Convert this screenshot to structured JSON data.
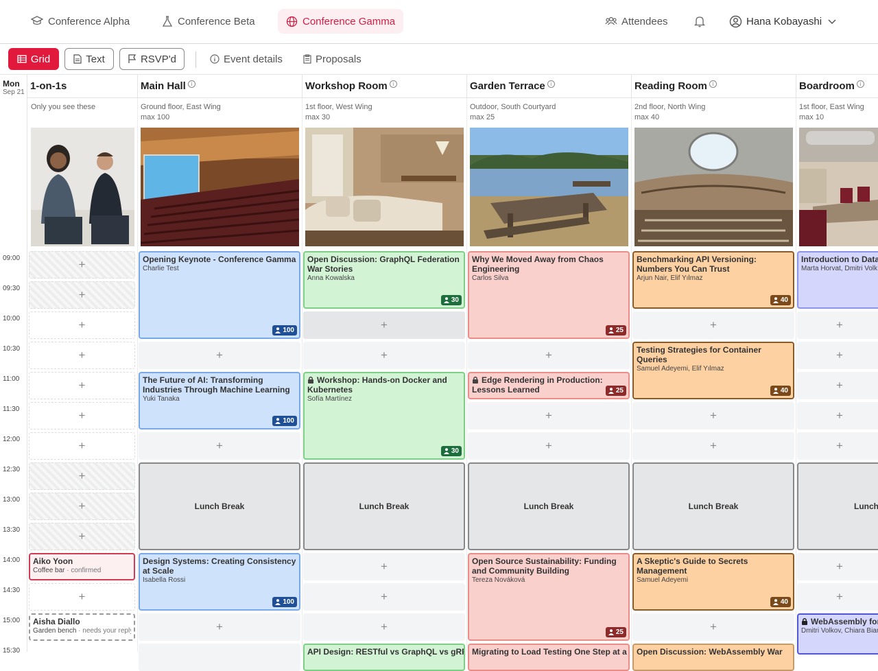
{
  "nav": {
    "tabs": [
      {
        "label": "Conference Alpha",
        "icon": "graduation-cap-icon"
      },
      {
        "label": "Conference Beta",
        "icon": "flask-icon"
      },
      {
        "label": "Conference Gamma",
        "icon": "globe-icon",
        "active": true
      }
    ],
    "attendees_label": "Attendees",
    "user_name": "Hana Kobayashi"
  },
  "toolbar": {
    "grid_label": "Grid",
    "text_label": "Text",
    "rsvp_label": "RSVP'd",
    "event_details_label": "Event details",
    "proposals_label": "Proposals"
  },
  "day": {
    "name": "Mon",
    "date": "Sep 21"
  },
  "times": [
    "09:00",
    "09:30",
    "10:00",
    "10:30",
    "11:00",
    "11:30",
    "12:00",
    "12:30",
    "13:00",
    "13:30",
    "14:00",
    "14:30",
    "15:00",
    "15:30"
  ],
  "columns": [
    {
      "name": "1-on-1s",
      "info": false,
      "desc1": "Only you see these",
      "desc2": ""
    },
    {
      "name": "Main Hall",
      "info": true,
      "desc1": "Ground floor, East Wing",
      "desc2": "max 100"
    },
    {
      "name": "Workshop Room",
      "info": true,
      "desc1": "1st floor, West Wing",
      "desc2": "max 30"
    },
    {
      "name": "Garden Terrace",
      "info": true,
      "desc1": "Outdoor, South Courtyard",
      "desc2": "max 25"
    },
    {
      "name": "Reading Room",
      "info": true,
      "desc1": "2nd floor, North Wing",
      "desc2": "max 40"
    },
    {
      "name": "Boardroom",
      "info": true,
      "desc1": "1st floor, East Wing",
      "desc2": "max 10"
    }
  ],
  "plus": "+",
  "events": {
    "keynote": {
      "title": "Opening Keynote - Conference Gamma",
      "speakers": "Charlie Test",
      "cap": "100"
    },
    "ai": {
      "title": "The Future of AI: Transforming Industries Through Machine Learning",
      "speakers": "Yuki Tanaka",
      "cap": "100"
    },
    "design": {
      "title": "Design Systems: Creating Consistency at Scale",
      "speakers": "Isabella Rossi",
      "cap": "100"
    },
    "graphql": {
      "title": "Open Discussion: GraphQL Federation War Stories",
      "speakers": "Anna Kowalska",
      "cap": "30"
    },
    "docker": {
      "title": "Workshop: Hands-on Docker and Kubernetes",
      "speakers": "Sofía Martínez",
      "cap": "30"
    },
    "api": {
      "title": "API Design: RESTful vs GraphQL vs gRPC",
      "speakers": ""
    },
    "chaos": {
      "title": "Why We Moved Away from Chaos Engineering",
      "speakers": "Carlos Silva",
      "cap": "25"
    },
    "edge": {
      "title": "Edge Rendering in Production: Lessons Learned",
      "speakers": "",
      "cap": "25"
    },
    "oss": {
      "title": "Open Source Sustainability: Funding and Community Building",
      "speakers": "Tereza Nováková",
      "cap": "25"
    },
    "migrating": {
      "title": "Migrating to Load Testing One Step at a",
      "speakers": ""
    },
    "bench": {
      "title": "Benchmarking API Versioning: Numbers You Can Trust",
      "speakers": "Arjun Nair, Elif Yılmaz",
      "cap": "40"
    },
    "testing": {
      "title": "Testing Strategies for Container Queries",
      "speakers": "Samuel Adeyemi, Elif Yılmaz",
      "cap": "40"
    },
    "secrets": {
      "title": "A Skeptic's Guide to Secrets Management",
      "speakers": "Samuel Adeyemi",
      "cap": "40"
    },
    "wasm_disc": {
      "title": "Open Discussion: WebAssembly War",
      "speakers": ""
    },
    "intro": {
      "title": "Introduction to Datab",
      "speakers": "Marta Horvat, Dmitri Volk"
    },
    "wasm": {
      "title": "WebAssembly for",
      "speakers": "Dmitri Volkov, Chiara Bian"
    },
    "lunch": {
      "title": "Lunch Break",
      "short": "Lunch"
    }
  },
  "meetings": [
    {
      "name": "Aiko Yoon",
      "place": "Coffee bar",
      "status": "· confirmed"
    },
    {
      "name": "Aisha Diallo",
      "place": "Garden bench",
      "status": "· needs your reply"
    }
  ],
  "colors": {
    "accent": "#e0193d",
    "blue": "#cfe2fb",
    "green": "#d3f3d5",
    "red": "#fad0cd",
    "orange": "#fed1a3",
    "purple": "#d4d6fb"
  }
}
